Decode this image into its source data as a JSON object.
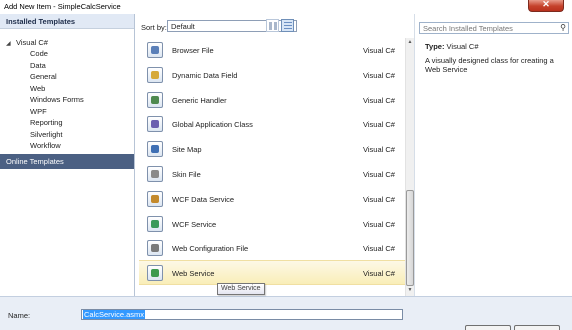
{
  "window": {
    "title": "Add New Item - SimpleCalcService",
    "close_glyph": "✕"
  },
  "left": {
    "header": "Installed Templates",
    "root": "Visual C#",
    "children": [
      "Code",
      "Data",
      "General",
      "Web",
      "Windows Forms",
      "WPF",
      "Reporting",
      "Silverlight",
      "Workflow"
    ],
    "online": "Online Templates"
  },
  "toolbar": {
    "sort_label": "Sort by:",
    "sort_value": "Default"
  },
  "items": [
    {
      "name": "Browser File",
      "lang": "Visual C#",
      "icon": "browser-file-icon",
      "color": "#5a7fb8"
    },
    {
      "name": "Dynamic Data Field",
      "lang": "Visual C#",
      "icon": "dynamic-data-field-icon",
      "color": "#d6a93a"
    },
    {
      "name": "Generic Handler",
      "lang": "Visual C#",
      "icon": "generic-handler-icon",
      "color": "#4f8a4f"
    },
    {
      "name": "Global Application Class",
      "lang": "Visual C#",
      "icon": "global-application-class-icon",
      "color": "#6b5fb0"
    },
    {
      "name": "Site Map",
      "lang": "Visual C#",
      "icon": "site-map-icon",
      "color": "#3f6fb4"
    },
    {
      "name": "Skin File",
      "lang": "Visual C#",
      "icon": "skin-file-icon",
      "color": "#8a8a8a"
    },
    {
      "name": "WCF Data Service",
      "lang": "Visual C#",
      "icon": "wcf-data-service-icon",
      "color": "#c48a2c"
    },
    {
      "name": "WCF Service",
      "lang": "Visual C#",
      "icon": "wcf-service-icon",
      "color": "#3b9a5a"
    },
    {
      "name": "Web Configuration File",
      "lang": "Visual C#",
      "icon": "web-configuration-file-icon",
      "color": "#7a7a7a"
    },
    {
      "name": "Web Service",
      "lang": "Visual C#",
      "icon": "web-service-icon",
      "color": "#3c9a4e",
      "selected": true
    }
  ],
  "right": {
    "search_placeholder": "Search Installed Templates",
    "type_label": "Type:",
    "type_value": "Visual C#",
    "description": "A visually designed class for creating a Web Service"
  },
  "bottom": {
    "name_label": "Name:",
    "name_value": "CalcService.asmx"
  },
  "tooltip": "Web Service"
}
